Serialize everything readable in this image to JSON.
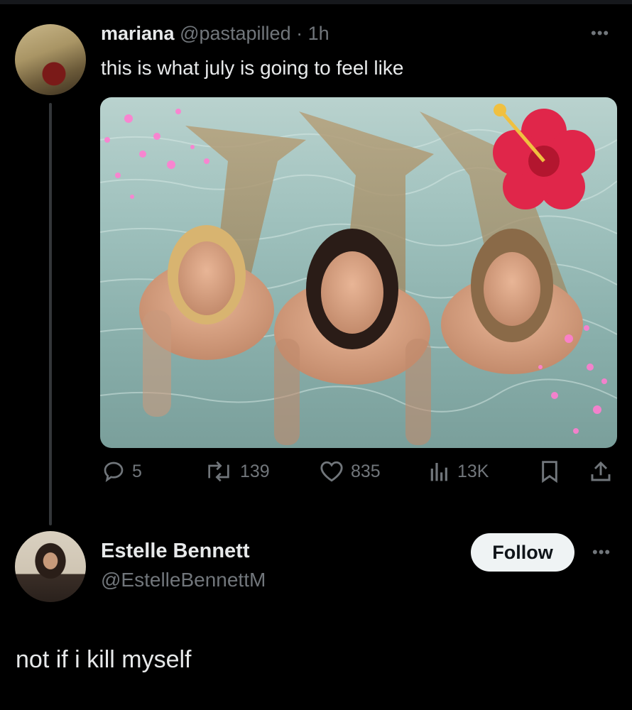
{
  "tweet": {
    "author_name": "mariana",
    "handle": "@pastapilled",
    "separator": "·",
    "time": "1h",
    "text": "this is what july is going to feel like",
    "media": {
      "description_icons": [
        "mermaid-photo",
        "hibiscus-sticker",
        "sparkle-sticker"
      ]
    },
    "actions": {
      "replies": "5",
      "reposts": "139",
      "likes": "835",
      "views": "13K"
    },
    "more_icon": "more-horizontal-icon"
  },
  "reply": {
    "author_name": "Estelle Bennett",
    "handle": "@EstelleBennettM",
    "follow_label": "Follow",
    "text": "not if i kill myself",
    "more_icon": "more-horizontal-icon"
  },
  "colors": {
    "background": "#000000",
    "text": "#e7e9ea",
    "muted": "#71767b",
    "follow_bg": "#eff3f4",
    "thread_line": "#333639"
  }
}
